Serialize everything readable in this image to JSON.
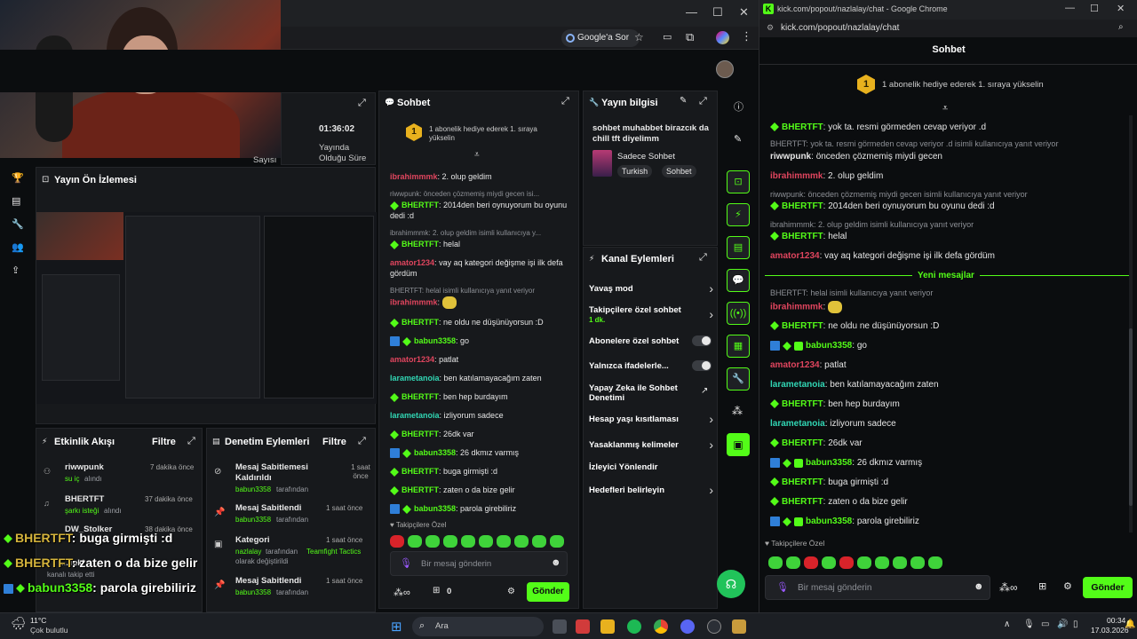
{
  "left_browser": {
    "search_chip": "Google'a Sor"
  },
  "stream_stats": {
    "duration": "01:36:02",
    "duration_label": "Yayında Olduğu Süre",
    "viewers_label_partial": "Sayısı"
  },
  "preview": {
    "title": "Yayın Ön İzlemesi"
  },
  "activity": {
    "title": "Etkinlik Akışı",
    "filter": "Filtre",
    "items": [
      {
        "user": "riwwpunk",
        "action": "su iç",
        "action_suffix": "alındı",
        "time": "7 dakika önce"
      },
      {
        "user": "BHERTFT",
        "action": "şarkı isteği",
        "action_suffix": "alındı",
        "time": "37 dakika önce"
      },
      {
        "user": "DW_Stolker",
        "action": "",
        "action_suffix": "",
        "time": "38 dakika önce"
      },
      {
        "user": "...Teki",
        "action": "kanalı takip etti",
        "action_suffix": "",
        "time": ""
      }
    ]
  },
  "moderation": {
    "title": "Denetim Eylemleri",
    "filter": "Filtre",
    "items": [
      {
        "title": "Mesaj Sabitlemesi Kaldırıldı",
        "by": "babun3358",
        "by_suffix": "tarafından",
        "time": "1 saat önce"
      },
      {
        "title": "Mesaj Sabitlendi",
        "by": "babun3358",
        "by_suffix": "tarafından",
        "time": "1 saat önce"
      },
      {
        "title": "Kategori",
        "by": "nazlalay",
        "by_suffix": "tarafından",
        "extra": "Teamfight Tactics",
        "extra2": "olarak değiştirildi",
        "time": "1 saat önce"
      },
      {
        "title": "Mesaj Sabitlendi",
        "by": "babun3358",
        "by_suffix": "tarafından",
        "time": "1 saat önce"
      }
    ]
  },
  "chat_mid": {
    "title": "Sohbet",
    "gift_banner": "1 abonelik hediye ederek 1. sıraya yükselin",
    "gift_rank": "1",
    "followers_only": "Takipçilere Özel",
    "input_placeholder": "Bir mesaj gönderin",
    "send": "Gönder",
    "points": "0",
    "messages": [
      {
        "user": "ibrahimmmk",
        "text": "2. olup geldim",
        "color": "red"
      },
      {
        "reply": "riwwpunk: önceden çözmemiş miydi gecen isi...",
        "user": "BHERTFT",
        "text": "2014den beri oynuyorum bu oyunu dedi :d",
        "color": "green"
      },
      {
        "reply": "ibrahimmmk: 2. olup geldim isimli kullanıcıya y...",
        "user": "BHERTFT",
        "text": "helal",
        "color": "green"
      },
      {
        "user": "amator1234",
        "text": "vay aq kategori değişme işi ilk defa gördüm",
        "color": "red"
      },
      {
        "reply": "BHERTFT: helal isimli kullanıcıya yanıt veriyor",
        "user": "ibrahimmmk",
        "text": "",
        "color": "red"
      },
      {
        "user": "BHERTFT",
        "text": "ne oldu ne düşünüyorsun :D",
        "color": "green"
      },
      {
        "user": "babun3358",
        "text": "go",
        "color": "green"
      },
      {
        "user": "amator1234",
        "text": "patlat",
        "color": "red"
      },
      {
        "user": "larametanoia",
        "text": "ben katılamayacağım zaten",
        "color": "teal"
      },
      {
        "user": "BHERTFT",
        "text": "ben hep burdayım",
        "color": "green"
      },
      {
        "user": "larametanoia",
        "text": "izliyorum sadece",
        "color": "teal"
      },
      {
        "user": "BHERTFT",
        "text": "26dk var",
        "color": "green"
      },
      {
        "user": "babun3358",
        "text": "26 dkmız varmış",
        "color": "green"
      },
      {
        "user": "BHERTFT",
        "text": "buga girmişti :d",
        "color": "green"
      },
      {
        "user": "BHERTFT",
        "text": "zaten o da bize gelir",
        "color": "green"
      },
      {
        "user": "babun3358",
        "text": "parola girebiliriz",
        "color": "green"
      }
    ]
  },
  "stream_info": {
    "title": "Yayın bilgisi",
    "stream_title": "sohbet muhabbet birazcık da chill tft diyelimm",
    "category": "Sadece Sohbet",
    "tags": [
      "Turkish",
      "Sohbet"
    ]
  },
  "channel_actions": {
    "title": "Kanal Eylemleri",
    "items": [
      {
        "label": "Yavaş mod",
        "sub": ""
      },
      {
        "label": "Takipçilere özel sohbet",
        "sub": "1 dk."
      },
      {
        "label": "Abonelere özel sohbet",
        "sub": ""
      },
      {
        "label": "Yalnızca ifadelerle...",
        "sub": ""
      },
      {
        "label": "Yapay Zeka ile Sohbet Denetimi",
        "sub": ""
      },
      {
        "label": "Hesap yaşı kısıtlaması",
        "sub": ""
      },
      {
        "label": "Yasaklanmış kelimeler",
        "sub": ""
      },
      {
        "label": "İzleyici Yönlendir",
        "sub": ""
      },
      {
        "label": "Hedefleri belirleyin",
        "sub": ""
      }
    ]
  },
  "popout": {
    "window_title": "kick.com/popout/nazlalay/chat - Google Chrome",
    "url": "kick.com/popout/nazlalay/chat",
    "header": "Sohbet",
    "gift_banner": "1 abonelik hediye ederek 1. sıraya yükselin",
    "gift_rank": "1",
    "new_messages": "Yeni mesajlar",
    "followers_only": "Takipçilere Özel",
    "input_placeholder": "Bir mesaj gönderin",
    "send": "Gönder",
    "messages": [
      {
        "user": "BHERTFT",
        "text": "yok ta. resmi görmeden cevap veriyor .d"
      },
      {
        "reply": "BHERTFT: yok ta. resmi görmeden cevap veriyor .d isimli kullanıcıya yanıt veriyor"
      },
      {
        "user": "riwwpunk",
        "text": "önceden çözmemiş miydi gecen"
      },
      {
        "user": "ibrahimmmk",
        "text": "2. olup geldim"
      },
      {
        "reply": "riwwpunk: önceden çözmemiş miydi gecen isimli kullanıcıya yanıt veriyor"
      },
      {
        "user": "BHERTFT",
        "text": "2014den beri oynuyorum bu oyunu dedi :d"
      },
      {
        "reply": "ibrahimmmk: 2. olup geldim isimli kullanıcıya yanıt veriyor"
      },
      {
        "user": "BHERTFT",
        "text": "helal"
      },
      {
        "user": "amator1234",
        "text": "vay aq kategori değişme işi ilk defa gördüm"
      },
      {
        "reply": "BHERTFT: helal isimli kullanıcıya yanıt veriyor"
      },
      {
        "user": "ibrahimmmk",
        "text": ""
      },
      {
        "user": "BHERTFT",
        "text": "ne oldu ne düşünüyorsun :D"
      },
      {
        "user": "babun3358",
        "text": "go"
      },
      {
        "user": "amator1234",
        "text": "patlat"
      },
      {
        "user": "larametanoia",
        "text": "ben katılamayacağım zaten"
      },
      {
        "user": "BHERTFT",
        "text": "ben hep burdayım"
      },
      {
        "user": "larametanoia",
        "text": "izliyorum sadece"
      },
      {
        "user": "BHERTFT",
        "text": "26dk var"
      },
      {
        "user": "babun3358",
        "text": "26 dkmız varmış"
      },
      {
        "user": "BHERTFT",
        "text": "buga girmişti :d"
      },
      {
        "user": "BHERTFT",
        "text": "zaten o da bize gelir"
      },
      {
        "user": "babun3358",
        "text": "parola girebiliriz"
      }
    ]
  },
  "overlay": [
    {
      "user": "BHERTFT",
      "text": ": buga girmişti :d"
    },
    {
      "user": "BHERTFT",
      "text": ": zaten o da bize gelir"
    },
    {
      "user": "babun3358",
      "text": ": parola girebiliriz"
    }
  ],
  "taskbar": {
    "weather_temp": "11°C",
    "weather_desc": "Çok bulutlu",
    "search": "Ara",
    "time": "00:34",
    "date": "17.03.2026"
  },
  "colors": {
    "accent": "#53fc18",
    "red_user": "#e0455e",
    "teal_user": "#31d6b4"
  }
}
